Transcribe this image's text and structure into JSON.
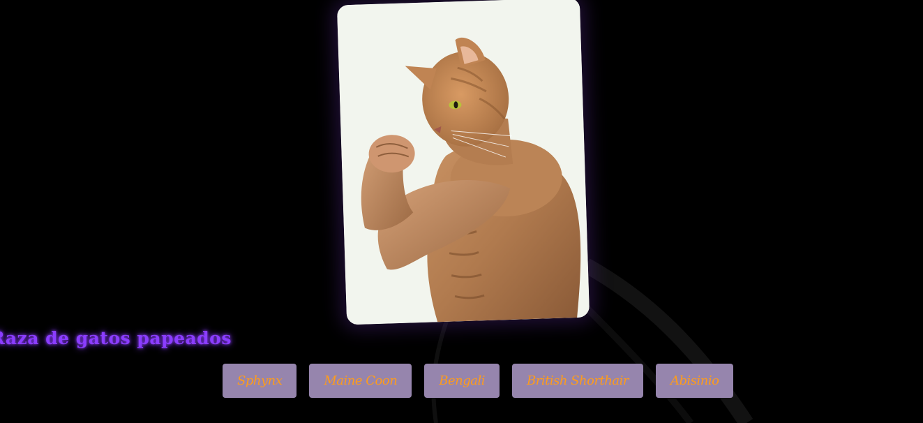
{
  "page": {
    "title": "Raza de gatos papeados"
  },
  "hero_image": {
    "alt": "muscular cat flexing"
  },
  "breeds": [
    {
      "label": "Sphynx"
    },
    {
      "label": "Maine Coon"
    },
    {
      "label": "Bengali"
    },
    {
      "label": "British Shorthair"
    },
    {
      "label": "Abisinio"
    }
  ],
  "colors": {
    "background": "#000000",
    "title": "#8b3dff",
    "button_bg": "#9685ad",
    "button_text": "#ff9c1a",
    "card_glow": "#582c96"
  }
}
